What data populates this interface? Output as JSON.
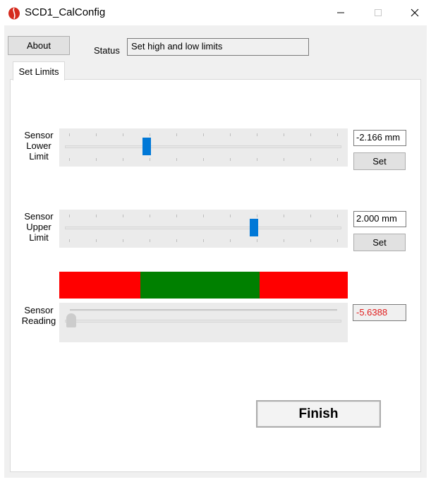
{
  "window": {
    "title": "SCD1_CalConfig",
    "icon": "red-bean-app-icon",
    "controls": [
      "minimize-icon",
      "maximize-icon",
      "close-icon"
    ]
  },
  "toolbar": {
    "about_label": "About",
    "status_label": "Status",
    "status_value": "Set high and low limits"
  },
  "tabs": [
    {
      "label": "Set Limits",
      "selected": true
    }
  ],
  "lower_limit": {
    "label_line1": "Sensor",
    "label_line2": "Lower",
    "label_line3": "Limit",
    "value": "-2.166 mm",
    "set_label": "Set",
    "slider_fraction": 0.29
  },
  "upper_limit": {
    "label_line1": "Sensor",
    "label_line2": "Upper",
    "label_line3": "Limit",
    "value": "2.000 mm",
    "set_label": "Set",
    "slider_fraction": 0.69
  },
  "range_indicator": {
    "segments": [
      {
        "color": "#ff0000",
        "fraction": 0.28
      },
      {
        "color": "#008000",
        "fraction": 0.415
      },
      {
        "color": "#ff0000",
        "fraction": 0.305
      }
    ]
  },
  "reading": {
    "label_line1": "Sensor",
    "label_line2": "Reading",
    "value": "-5.6388",
    "value_color": "#e01c1c",
    "slider_fraction": 0.0
  },
  "finish_label": "Finish",
  "accent_color": "#0078d7"
}
